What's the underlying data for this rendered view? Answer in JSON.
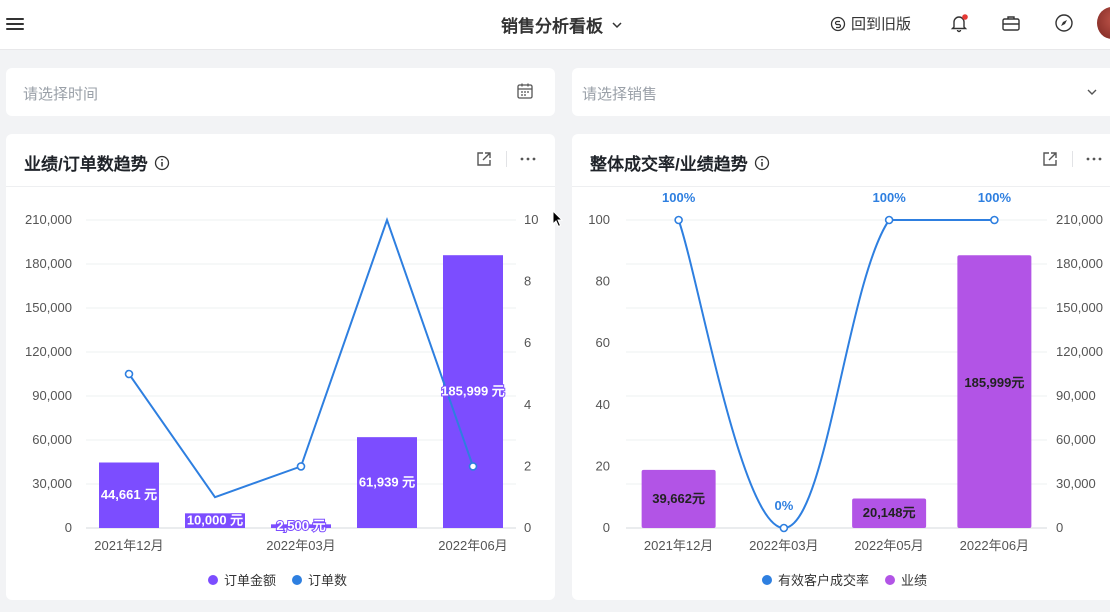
{
  "header": {
    "title": "销售分析看板",
    "back_label": "回到旧版"
  },
  "filters": {
    "time_placeholder": "请选择时间",
    "sales_placeholder": "请选择销售"
  },
  "colors": {
    "purple": "#7c4dff",
    "blue": "#2e7fe0",
    "violet": "#b254e6"
  },
  "icons": [
    "menu-icon",
    "chevron-down-icon",
    "refresh-icon",
    "bell-icon",
    "briefcase-icon",
    "compass-icon",
    "calendar-icon",
    "info-icon",
    "external-link-icon",
    "more-icon"
  ],
  "chart_data": [
    {
      "type": "bar",
      "title": "业绩/订单数趋势",
      "x_tick_labels": [
        "2021年12月",
        "2022年03月",
        "2022年06月"
      ],
      "y_left": {
        "ticks": [
          "0",
          "30,000",
          "60,000",
          "90,000",
          "120,000",
          "150,000",
          "180,000",
          "210,000"
        ],
        "lim": [
          0,
          210000
        ]
      },
      "y_right": {
        "ticks": [
          "0",
          "2",
          "4",
          "6",
          "8",
          "10"
        ],
        "lim": [
          0,
          10
        ]
      },
      "series": [
        {
          "name": "订单金额",
          "kind": "bar",
          "axis": "left",
          "values": [
            44661,
            10000,
            2500,
            61939,
            185999
          ],
          "labels": [
            "44,661 元",
            "10,000 元",
            "2,500 元",
            "61,939 元",
            "185,999 元"
          ]
        },
        {
          "name": "订单数",
          "kind": "line",
          "axis": "right",
          "values": [
            5,
            1,
            2,
            10,
            2
          ]
        }
      ]
    },
    {
      "type": "bar",
      "title": "整体成交率/业绩趋势",
      "x_tick_labels": [
        "2021年12月",
        "2022年03月",
        "2022年05月",
        "2022年06月"
      ],
      "y_left": {
        "ticks": [
          "0",
          "20",
          "40",
          "60",
          "80",
          "100"
        ],
        "lim": [
          0,
          100
        ]
      },
      "y_right": {
        "ticks": [
          "0",
          "30,000",
          "60,000",
          "90,000",
          "120,000",
          "150,000",
          "180,000",
          "210,000"
        ],
        "lim": [
          0,
          210000
        ]
      },
      "series": [
        {
          "name": "有效客户成交率",
          "kind": "line",
          "axis": "left",
          "values": [
            100,
            0,
            100,
            100
          ],
          "labels": [
            "100%",
            "0%",
            "100%",
            "100%"
          ]
        },
        {
          "name": "业绩",
          "kind": "bar",
          "axis": "right",
          "values": [
            39662,
            0,
            20148,
            185999
          ],
          "labels": [
            "39,662元",
            "",
            "20,148元",
            "185,999元"
          ]
        }
      ]
    }
  ]
}
